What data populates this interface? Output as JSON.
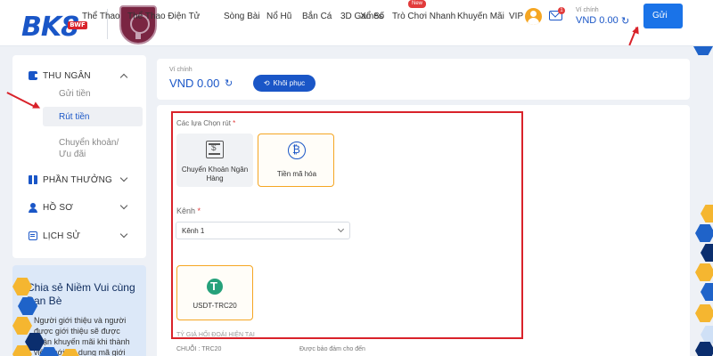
{
  "header": {
    "logo_text": "BK8",
    "logo_badge": "BWF",
    "nav": [
      "Thể Thao",
      "Thể Thao Điện Tử",
      "Sòng Bài",
      "Nổ Hũ",
      "Bắn Cá",
      "3D Games",
      "Xổ Số",
      "Trò Chơi Nhanh",
      "Khuyến Mãi",
      "VIP"
    ],
    "new_badge": "New",
    "mail_count": "1",
    "wallet_label": "Ví chính",
    "wallet_value": "VND 0.00",
    "deposit_label": "Gửi"
  },
  "sidebar": {
    "sections": [
      {
        "label": "THU NGÂN",
        "icon": "wallet-icon",
        "expanded": true
      },
      {
        "label": "PHẦN THƯỞNG",
        "icon": "gift-icon"
      },
      {
        "label": "HỒ SƠ",
        "icon": "user-icon"
      },
      {
        "label": "LỊCH SỬ",
        "icon": "history-icon"
      }
    ],
    "subitems": [
      "Gửi tiền",
      "Rút tiền",
      "Chuyển khoản/Ưu đãi"
    ],
    "active_subitem": "Rút tiền"
  },
  "promo": {
    "title": "Chia sẻ Niềm Vui cùng Bạn Bè",
    "text": "Người giới thiệu và người được giới thiệu sẽ được nhận khuyến mãi khi thành viên mới sử dụng mã giới"
  },
  "wallet": {
    "label": "Ví chính",
    "value": "VND 0.00",
    "restore_label": "Khôi phục"
  },
  "withdraw": {
    "options_label": "Các lựa Chọn rút",
    "options": [
      {
        "label": "Chuyển Khoản Ngân Hàng",
        "icon": "bank-icon",
        "selected": false
      },
      {
        "label": "Tiền mã hóa",
        "icon": "bitcoin-icon",
        "selected": true
      }
    ],
    "channel_label": "Kênh",
    "channel_value": "Kênh 1",
    "token_label": "USDT-TRC20",
    "rate_label": "TỶ GIÁ HỐI ĐOÁI HIỆN TẠI",
    "chain_label": "CHUỖI : TRC20",
    "guarantee_label": "Được bảo đảm cho đến"
  },
  "colors": {
    "brand": "#1a56c7",
    "accent": "#f5a623",
    "highlight": "#d9222a"
  }
}
